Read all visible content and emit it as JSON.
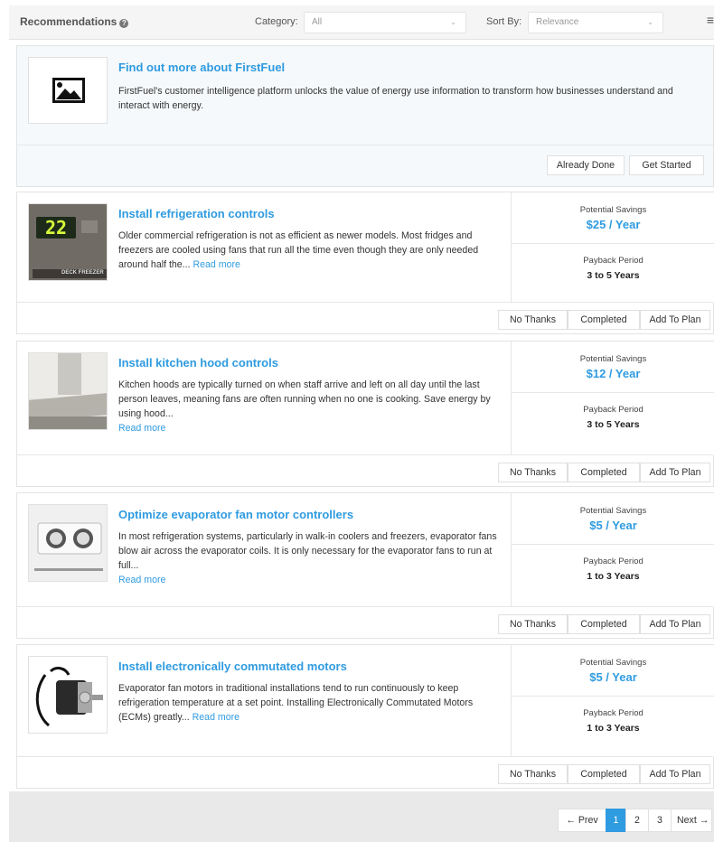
{
  "header": {
    "title": "Recommendations",
    "help_icon": "question-circle-icon",
    "category_label": "Category:",
    "category_value": "All",
    "sort_label": "Sort By:",
    "sort_value": "Relevance",
    "menu_icon": "hamburger-menu-icon"
  },
  "featured": {
    "title": "Find out more about FirstFuel",
    "description": "FirstFuel's customer intelligence platform unlocks the value of energy use information to transform how businesses understand and interact with energy.",
    "image_icon": "image-placeholder-icon",
    "already_done_label": "Already Done",
    "get_started_label": "Get Started"
  },
  "labels": {
    "potential_savings": "Potential Savings",
    "payback_period": "Payback Period",
    "no_thanks": "No Thanks",
    "completed": "Completed",
    "add_to_plan": "Add To Plan",
    "read_more": "Read more"
  },
  "recommendations": [
    {
      "title": "Install refrigeration controls",
      "description": "Older commercial refrigeration is not as efficient as newer models. Most fridges and freezers are cooled using fans that run all the time even though they are only needed around half the...",
      "image_text": "22",
      "image_caption": "DECK FREEZER",
      "savings": "$25 / Year",
      "payback": "3 to 5 Years"
    },
    {
      "title": "Install kitchen hood controls",
      "description": "Kitchen hoods are typically turned on when staff arrive and left on all day until the last person leaves, meaning fans are often running when no one is cooking. Save energy by using hood...",
      "savings": "$12 / Year",
      "payback": "3 to 5 Years"
    },
    {
      "title": "Optimize evaporator fan motor controllers",
      "description": "In most refrigeration systems, particularly in walk-in coolers and freezers, evaporator fans blow air across the evaporator coils. It is only necessary for the evaporator fans to run at full...",
      "savings": "$5 / Year",
      "payback": "1 to 3 Years"
    },
    {
      "title": "Install electronically commutated motors",
      "description": "Evaporator fan motors in traditional installations tend to run continuously to keep refrigeration temperature at a set point. Installing Electronically Commutated Motors (ECMs) greatly...",
      "savings": "$5 / Year",
      "payback": "1 to 3 Years"
    }
  ],
  "pagination": {
    "prev": "← Prev",
    "pages": [
      "1",
      "2",
      "3"
    ],
    "current": "1",
    "next": "Next →"
  },
  "colors": {
    "accent": "#2f9be0",
    "featured_bg": "#f6f9fb",
    "bottom_bar": "#e9e9e9"
  }
}
